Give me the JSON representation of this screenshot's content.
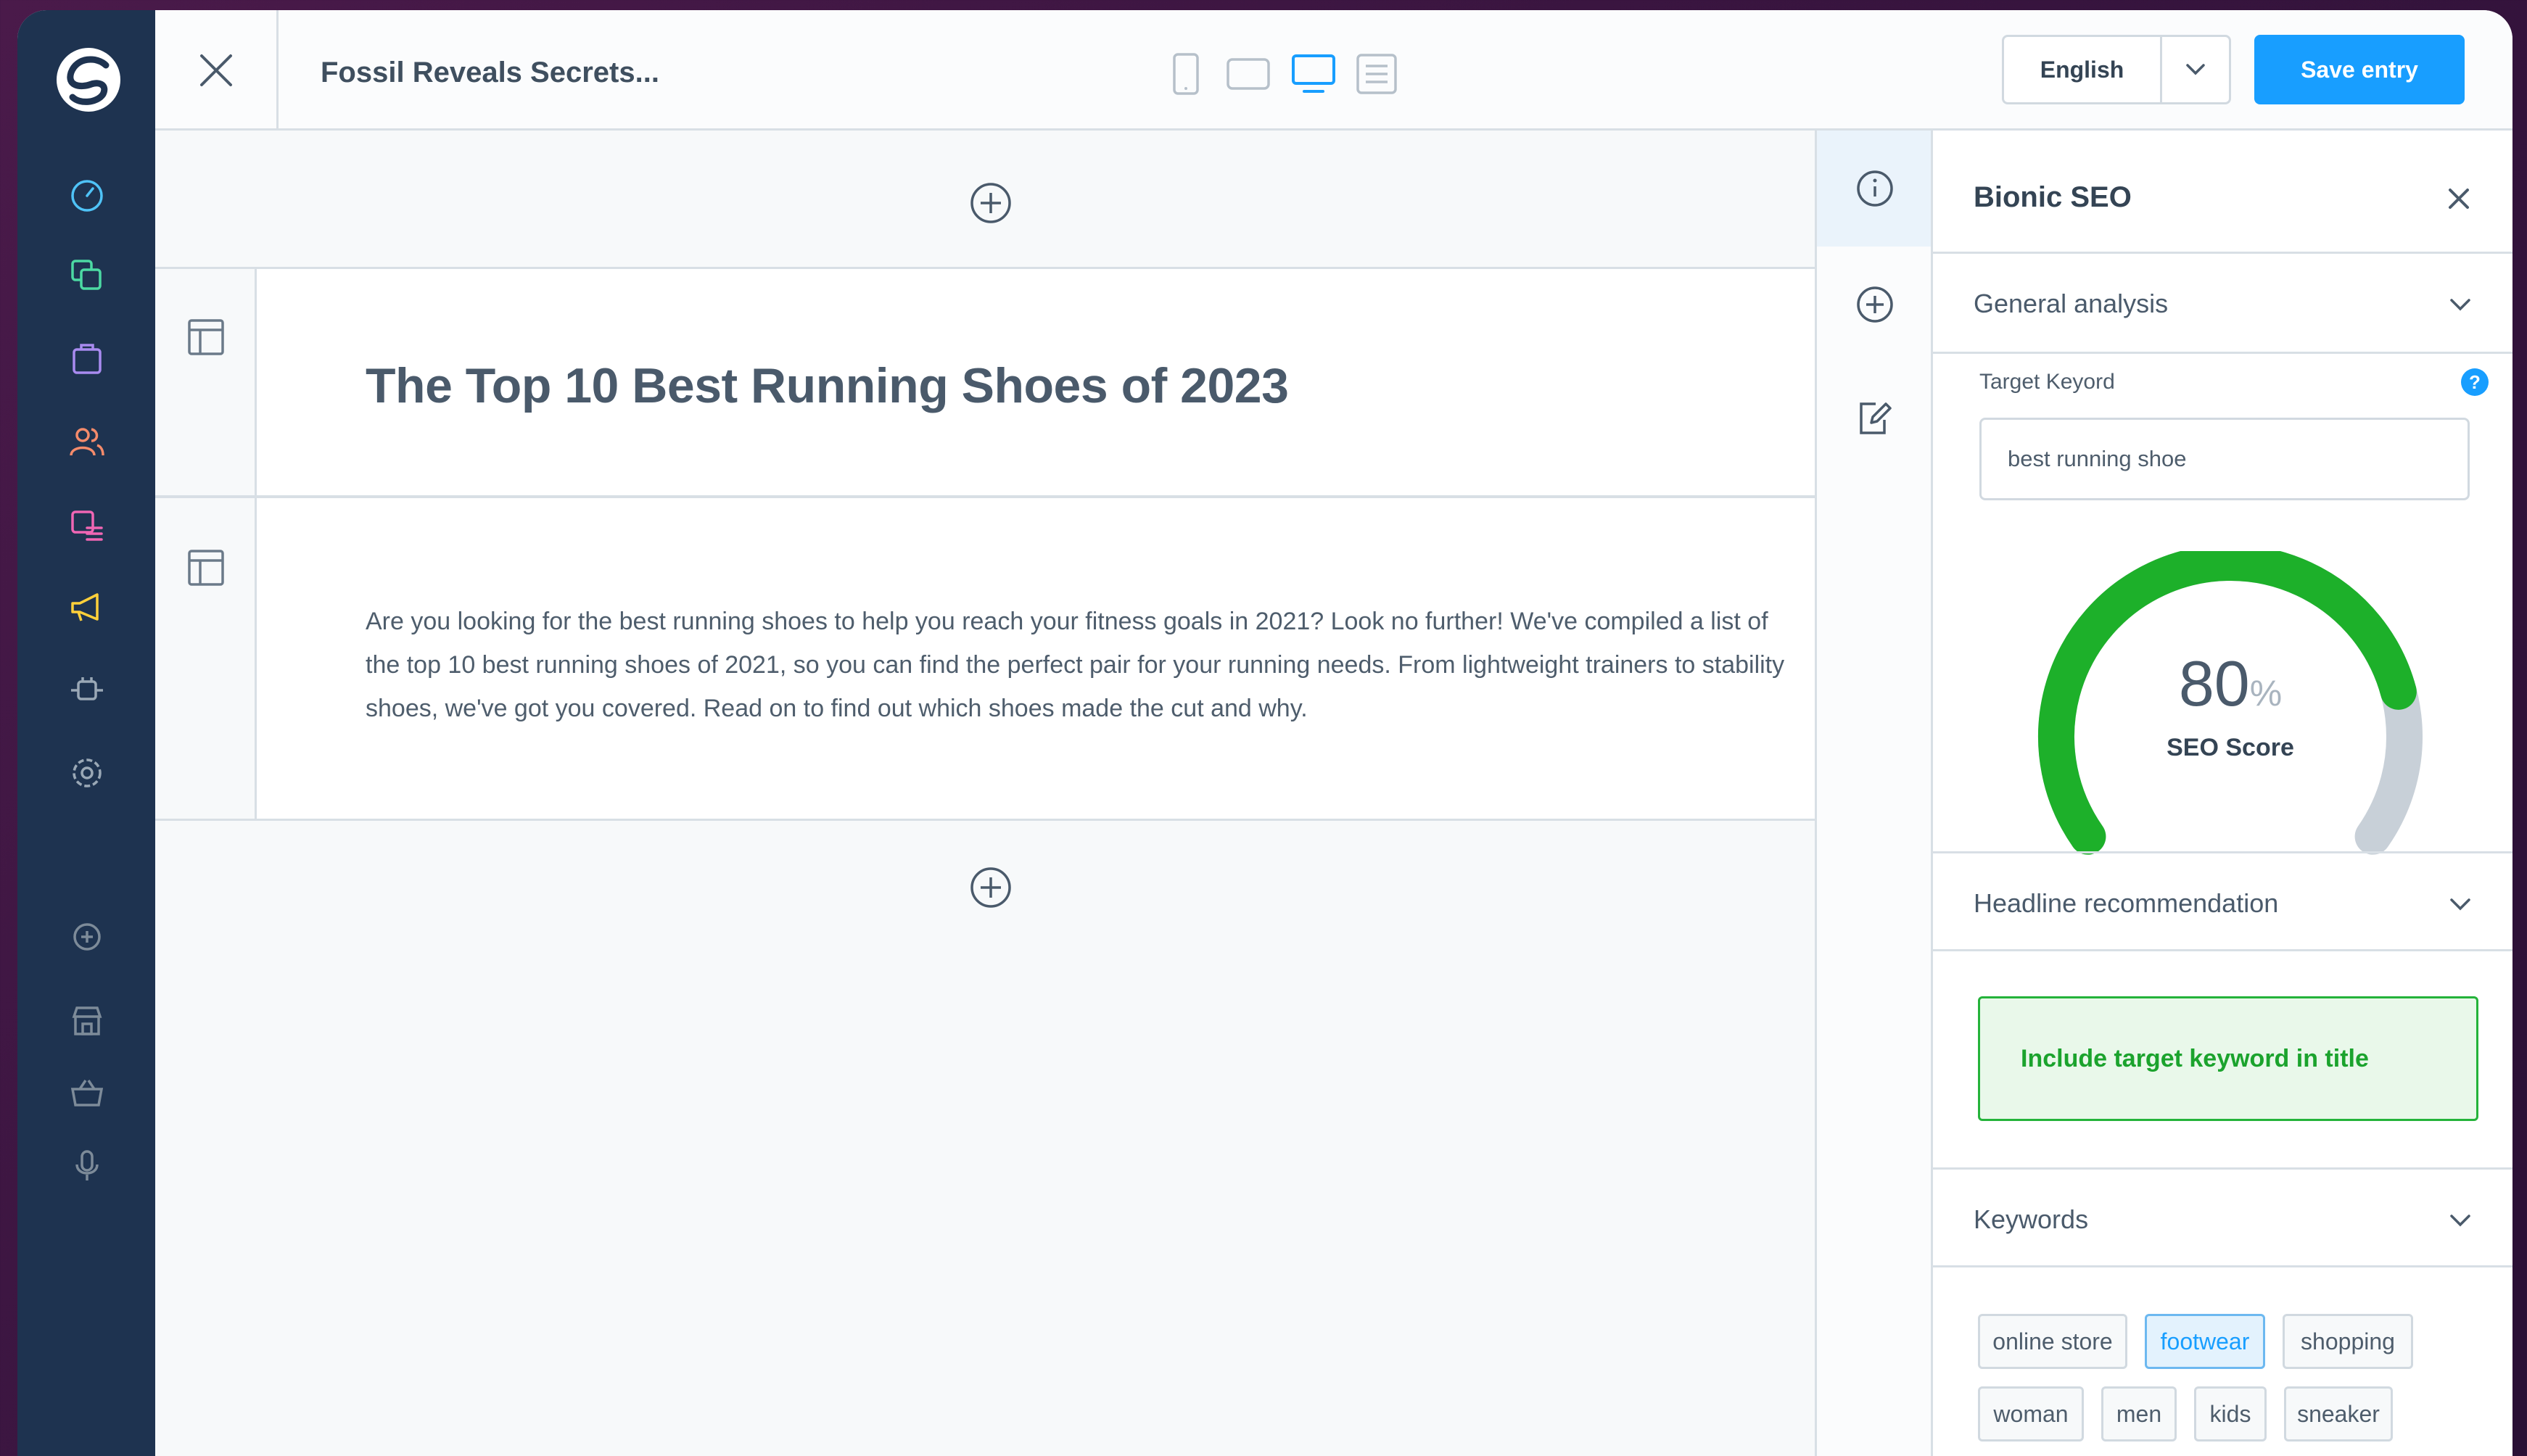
{
  "topbar": {
    "document_title": "Fossil Reveals Secrets...",
    "language": "English",
    "save_label": "Save entry",
    "devices": [
      "phone-icon",
      "tablet-icon",
      "desktop-icon",
      "list-view-icon"
    ]
  },
  "sidebar": {
    "items": [
      "dashboard-icon",
      "catalogues-icon",
      "orders-icon",
      "customers-icon",
      "content-icon",
      "marketing-icon",
      "extensions-icon",
      "settings-icon",
      "add-icon",
      "store-icon",
      "basket-icon",
      "microphone-icon"
    ]
  },
  "editor": {
    "heading": "The Top 10 Best Running Shoes of 2023",
    "paragraph": "Are you looking for the best running shoes to help you reach your fitness goals in 2021? Look no further! We've compiled a list of the top 10 best running shoes of 2021, so you can find the perfect pair for your running needs. From lightweight trainers to stability shoes, we've got you covered. Read on to find out which shoes made the cut and why."
  },
  "panel": {
    "title": "Bionic SEO",
    "general_analysis": "General analysis",
    "target_keyword_label": "Target Keyord",
    "help": "?",
    "target_keyword_value": "best running shoe",
    "seo_score": 80,
    "seo_score_text": "80",
    "seo_score_unit": "%",
    "seo_score_label": "SEO Score",
    "headline_recommendation": "Headline recommendation",
    "recommendation_text": "Include target keyword in title",
    "keywords_label": "Keywords",
    "keywords": [
      "online store",
      "footwear",
      "shopping",
      "woman",
      "men",
      "kids",
      "sneaker"
    ],
    "selected_keyword": "footwear"
  },
  "colors": {
    "accent": "#189eff",
    "sidebar": "#1e3350",
    "gauge_good": "#1db02a",
    "gauge_rest": "#c8d0d8"
  }
}
